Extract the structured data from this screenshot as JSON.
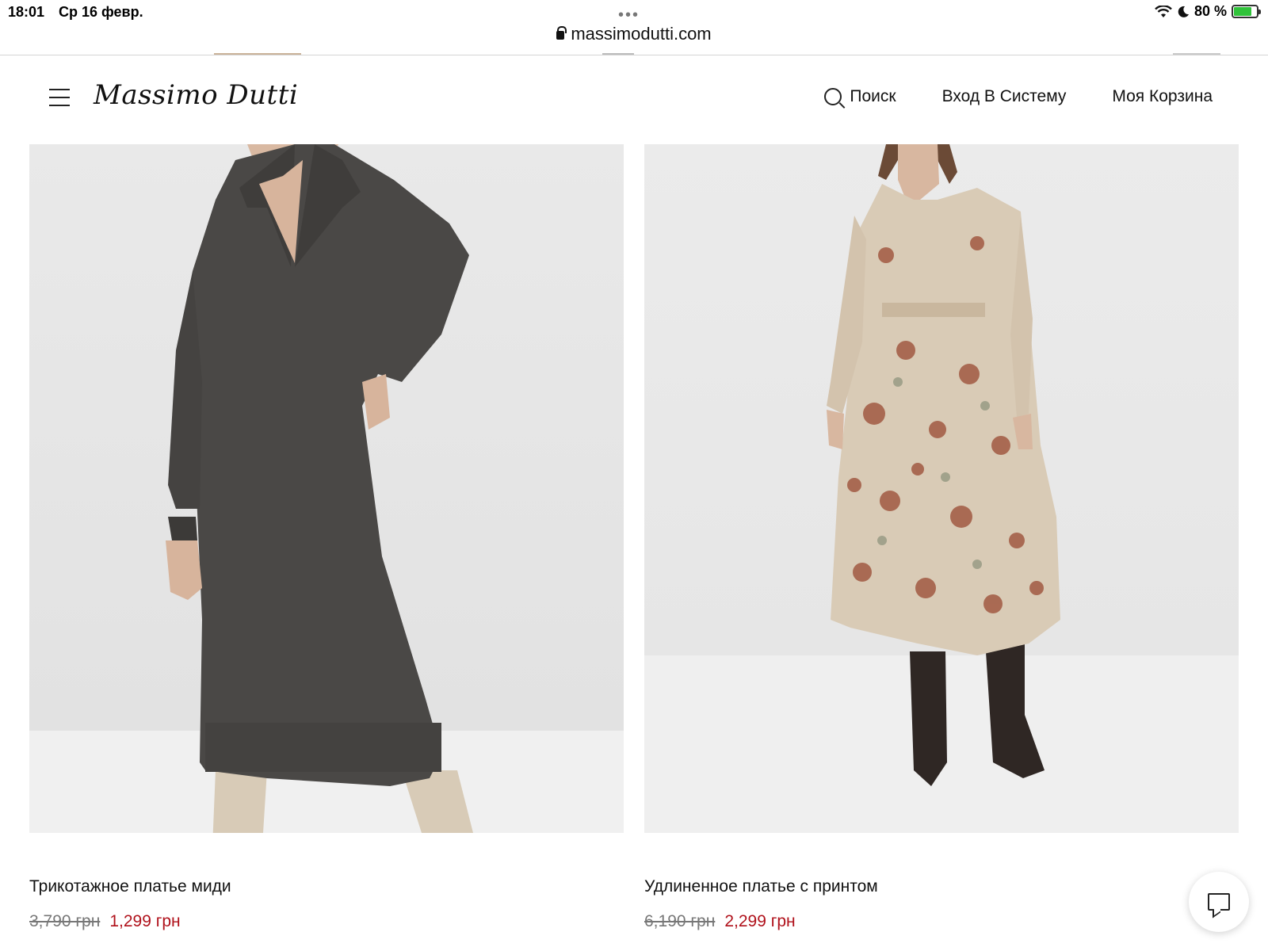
{
  "status_bar": {
    "time": "18:01",
    "date": "Ср 16 февр.",
    "battery_text": "80 %",
    "battery_level": 0.8,
    "icons": [
      "wifi-icon",
      "moon-icon",
      "battery-icon"
    ]
  },
  "browser": {
    "url": "massimodutti.com"
  },
  "header": {
    "logo": "Massimo Dutti",
    "search_label": "Поиск",
    "login_label": "Вход В Систему",
    "cart_label": "Моя Корзина"
  },
  "products": [
    {
      "name": "Трикотажное платье миди",
      "price_old": "3,790 грн",
      "price_new": "1,299 грн"
    },
    {
      "name": "Удлиненное платье с принтом",
      "price_old": "6,190 грн",
      "price_new": "2,299 грн"
    }
  ],
  "colors": {
    "sale_price": "#b0111b",
    "knit_dress": "#4a4846",
    "floral_dress": "#d9cbb6",
    "floral_print": "#9a4a32",
    "background": "#e7e7e7"
  }
}
